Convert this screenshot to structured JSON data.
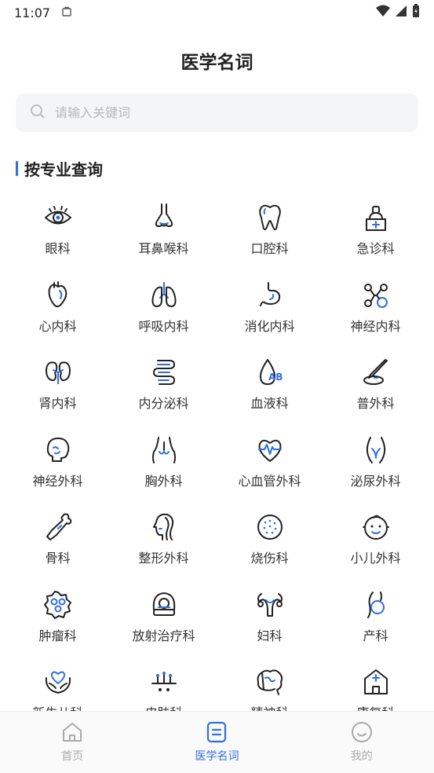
{
  "status_bar": {
    "time": "11:07"
  },
  "header": {
    "title": "医学名词"
  },
  "search": {
    "placeholder": "请输入关键词"
  },
  "section": {
    "title": "按专业查询"
  },
  "departments": [
    {
      "label": "眼科",
      "icon": "eye-icon"
    },
    {
      "label": "耳鼻喉科",
      "icon": "nose-icon"
    },
    {
      "label": "口腔科",
      "icon": "tooth-icon"
    },
    {
      "label": "急诊科",
      "icon": "emergency-icon"
    },
    {
      "label": "心内科",
      "icon": "heart-icon"
    },
    {
      "label": "呼吸内科",
      "icon": "lungs-icon"
    },
    {
      "label": "消化内科",
      "icon": "stomach-icon"
    },
    {
      "label": "神经内科",
      "icon": "neuron-icon"
    },
    {
      "label": "肾内科",
      "icon": "kidney-icon"
    },
    {
      "label": "内分泌科",
      "icon": "intestine-icon"
    },
    {
      "label": "血液科",
      "icon": "blood-drop-icon"
    },
    {
      "label": "普外科",
      "icon": "scalpel-icon"
    },
    {
      "label": "神经外科",
      "icon": "skull-icon"
    },
    {
      "label": "胸外科",
      "icon": "chest-icon"
    },
    {
      "label": "心血管外科",
      "icon": "heart-pulse-icon"
    },
    {
      "label": "泌尿外科",
      "icon": "pelvis-icon"
    },
    {
      "label": "骨科",
      "icon": "bone-icon"
    },
    {
      "label": "整形外科",
      "icon": "face-profile-icon"
    },
    {
      "label": "烧伤科",
      "icon": "skin-icon"
    },
    {
      "label": "小儿外科",
      "icon": "baby-icon"
    },
    {
      "label": "肿瘤科",
      "icon": "tumor-cell-icon"
    },
    {
      "label": "放射治疗科",
      "icon": "scanner-icon"
    },
    {
      "label": "妇科",
      "icon": "uterus-icon"
    },
    {
      "label": "产科",
      "icon": "pregnancy-icon"
    },
    {
      "label": "新生儿科",
      "icon": "hands-heart-icon"
    },
    {
      "label": "皮肤科",
      "icon": "skin-layer-icon"
    },
    {
      "label": "精神科",
      "icon": "brain-icon"
    },
    {
      "label": "康复科",
      "icon": "hospital-icon"
    }
  ],
  "tabs": [
    {
      "label": "首页",
      "icon": "home-icon",
      "active": false
    },
    {
      "label": "医学名词",
      "icon": "document-icon",
      "active": true
    },
    {
      "label": "我的",
      "icon": "smile-icon",
      "active": false
    }
  ],
  "colors": {
    "accent": "#2f6fe4",
    "icon_stroke": "#222222",
    "inactive": "#aaaaaa"
  }
}
